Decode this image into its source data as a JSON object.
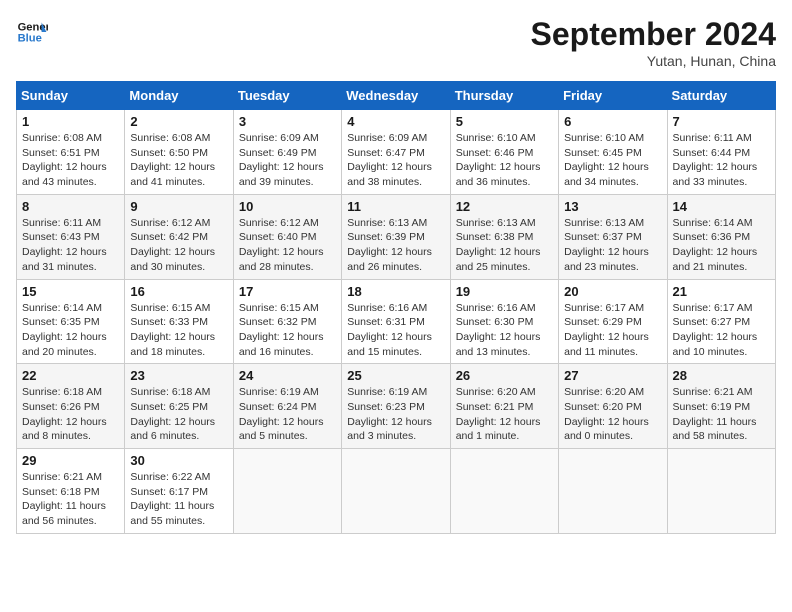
{
  "header": {
    "logo_line1": "General",
    "logo_line2": "Blue",
    "month_title": "September 2024",
    "location": "Yutan, Hunan, China"
  },
  "columns": [
    "Sunday",
    "Monday",
    "Tuesday",
    "Wednesday",
    "Thursday",
    "Friday",
    "Saturday"
  ],
  "weeks": [
    [
      {
        "day": "1",
        "info": "Sunrise: 6:08 AM\nSunset: 6:51 PM\nDaylight: 12 hours and 43 minutes."
      },
      {
        "day": "2",
        "info": "Sunrise: 6:08 AM\nSunset: 6:50 PM\nDaylight: 12 hours and 41 minutes."
      },
      {
        "day": "3",
        "info": "Sunrise: 6:09 AM\nSunset: 6:49 PM\nDaylight: 12 hours and 39 minutes."
      },
      {
        "day": "4",
        "info": "Sunrise: 6:09 AM\nSunset: 6:47 PM\nDaylight: 12 hours and 38 minutes."
      },
      {
        "day": "5",
        "info": "Sunrise: 6:10 AM\nSunset: 6:46 PM\nDaylight: 12 hours and 36 minutes."
      },
      {
        "day": "6",
        "info": "Sunrise: 6:10 AM\nSunset: 6:45 PM\nDaylight: 12 hours and 34 minutes."
      },
      {
        "day": "7",
        "info": "Sunrise: 6:11 AM\nSunset: 6:44 PM\nDaylight: 12 hours and 33 minutes."
      }
    ],
    [
      {
        "day": "8",
        "info": "Sunrise: 6:11 AM\nSunset: 6:43 PM\nDaylight: 12 hours and 31 minutes."
      },
      {
        "day": "9",
        "info": "Sunrise: 6:12 AM\nSunset: 6:42 PM\nDaylight: 12 hours and 30 minutes."
      },
      {
        "day": "10",
        "info": "Sunrise: 6:12 AM\nSunset: 6:40 PM\nDaylight: 12 hours and 28 minutes."
      },
      {
        "day": "11",
        "info": "Sunrise: 6:13 AM\nSunset: 6:39 PM\nDaylight: 12 hours and 26 minutes."
      },
      {
        "day": "12",
        "info": "Sunrise: 6:13 AM\nSunset: 6:38 PM\nDaylight: 12 hours and 25 minutes."
      },
      {
        "day": "13",
        "info": "Sunrise: 6:13 AM\nSunset: 6:37 PM\nDaylight: 12 hours and 23 minutes."
      },
      {
        "day": "14",
        "info": "Sunrise: 6:14 AM\nSunset: 6:36 PM\nDaylight: 12 hours and 21 minutes."
      }
    ],
    [
      {
        "day": "15",
        "info": "Sunrise: 6:14 AM\nSunset: 6:35 PM\nDaylight: 12 hours and 20 minutes."
      },
      {
        "day": "16",
        "info": "Sunrise: 6:15 AM\nSunset: 6:33 PM\nDaylight: 12 hours and 18 minutes."
      },
      {
        "day": "17",
        "info": "Sunrise: 6:15 AM\nSunset: 6:32 PM\nDaylight: 12 hours and 16 minutes."
      },
      {
        "day": "18",
        "info": "Sunrise: 6:16 AM\nSunset: 6:31 PM\nDaylight: 12 hours and 15 minutes."
      },
      {
        "day": "19",
        "info": "Sunrise: 6:16 AM\nSunset: 6:30 PM\nDaylight: 12 hours and 13 minutes."
      },
      {
        "day": "20",
        "info": "Sunrise: 6:17 AM\nSunset: 6:29 PM\nDaylight: 12 hours and 11 minutes."
      },
      {
        "day": "21",
        "info": "Sunrise: 6:17 AM\nSunset: 6:27 PM\nDaylight: 12 hours and 10 minutes."
      }
    ],
    [
      {
        "day": "22",
        "info": "Sunrise: 6:18 AM\nSunset: 6:26 PM\nDaylight: 12 hours and 8 minutes."
      },
      {
        "day": "23",
        "info": "Sunrise: 6:18 AM\nSunset: 6:25 PM\nDaylight: 12 hours and 6 minutes."
      },
      {
        "day": "24",
        "info": "Sunrise: 6:19 AM\nSunset: 6:24 PM\nDaylight: 12 hours and 5 minutes."
      },
      {
        "day": "25",
        "info": "Sunrise: 6:19 AM\nSunset: 6:23 PM\nDaylight: 12 hours and 3 minutes."
      },
      {
        "day": "26",
        "info": "Sunrise: 6:20 AM\nSunset: 6:21 PM\nDaylight: 12 hours and 1 minute."
      },
      {
        "day": "27",
        "info": "Sunrise: 6:20 AM\nSunset: 6:20 PM\nDaylight: 12 hours and 0 minutes."
      },
      {
        "day": "28",
        "info": "Sunrise: 6:21 AM\nSunset: 6:19 PM\nDaylight: 11 hours and 58 minutes."
      }
    ],
    [
      {
        "day": "29",
        "info": "Sunrise: 6:21 AM\nSunset: 6:18 PM\nDaylight: 11 hours and 56 minutes."
      },
      {
        "day": "30",
        "info": "Sunrise: 6:22 AM\nSunset: 6:17 PM\nDaylight: 11 hours and 55 minutes."
      },
      {
        "day": "",
        "info": ""
      },
      {
        "day": "",
        "info": ""
      },
      {
        "day": "",
        "info": ""
      },
      {
        "day": "",
        "info": ""
      },
      {
        "day": "",
        "info": ""
      }
    ]
  ]
}
